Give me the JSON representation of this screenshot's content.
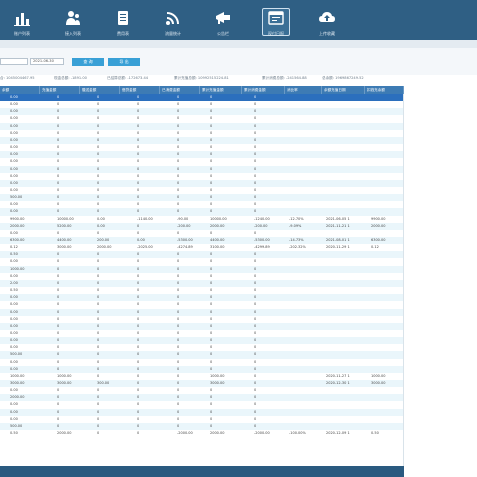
{
  "nav": [
    {
      "label": "账户列表",
      "icon": "bar-chart-icon"
    },
    {
      "label": "接入列表",
      "icon": "users-icon"
    },
    {
      "label": "费用表",
      "icon": "document-icon"
    },
    {
      "label": "流量统计",
      "icon": "signal-icon"
    },
    {
      "label": "公告栏",
      "icon": "megaphone-icon"
    },
    {
      "label": "现付日报",
      "icon": "window-report-icon",
      "active": true
    },
    {
      "label": "上传收藏",
      "icon": "cloud-upload-icon"
    }
  ],
  "filter": {
    "date_from": "",
    "date_to": "2021-06-30",
    "search_label": "查 询",
    "export_label": "导 出"
  },
  "summary": [
    "合: 1045004467.95",
    "现金总额: -1891.00",
    "已结算总额: -172673.44",
    "累计充值总额: 10992515224.81",
    "累计消费总额: -241564.88",
    "总余额: 1969867249.52"
  ],
  "columns": [
    "余额",
    "充值金额",
    "赠送金额",
    "借贷金额",
    "已消费金额",
    "累计充值金额",
    "累计消费金额",
    "消比率",
    "余额充值日期",
    "扣钱充余额"
  ],
  "rows": [
    [
      "0.00",
      "0",
      "0",
      "0",
      "0",
      "0",
      "0",
      "",
      "",
      ""
    ],
    [
      "0.00",
      "0",
      "0",
      "0",
      "0",
      "0",
      "0",
      "",
      "",
      ""
    ],
    [
      "0.00",
      "0",
      "0",
      "0",
      "0",
      "0",
      "0",
      "",
      "",
      ""
    ],
    [
      "0.00",
      "0",
      "0",
      "0",
      "0",
      "0",
      "0",
      "",
      "",
      ""
    ],
    [
      "0.00",
      "0",
      "0",
      "0",
      "0",
      "0",
      "0",
      "",
      "",
      ""
    ],
    [
      "0.00",
      "0",
      "0",
      "0",
      "0",
      "0",
      "0",
      "",
      "",
      ""
    ],
    [
      "0.00",
      "0",
      "0",
      "0",
      "0",
      "0",
      "0",
      "",
      "",
      ""
    ],
    [
      "0.00",
      "0",
      "0",
      "0",
      "0",
      "0",
      "0",
      "",
      "",
      ""
    ],
    [
      "0.00",
      "0",
      "0",
      "0",
      "0",
      "0",
      "0",
      "",
      "",
      ""
    ],
    [
      "0.00",
      "0",
      "0",
      "0",
      "0",
      "0",
      "0",
      "",
      "",
      ""
    ],
    [
      "0.00",
      "0",
      "0",
      "0",
      "0",
      "0",
      "0",
      "",
      "",
      ""
    ],
    [
      "0.00",
      "0",
      "0",
      "0",
      "0",
      "0",
      "0",
      "",
      "",
      ""
    ],
    [
      "0.00",
      "0",
      "0",
      "0",
      "0",
      "0",
      "0",
      "",
      "",
      ""
    ],
    [
      "0.00",
      "0",
      "0",
      "0",
      "0",
      "0",
      "0",
      "",
      "",
      ""
    ],
    [
      "500.00",
      "0",
      "0",
      "0",
      "0",
      "0",
      "0",
      "",
      "",
      ""
    ],
    [
      "0.00",
      "0",
      "0",
      "0",
      "0",
      "0",
      "0",
      "",
      "",
      ""
    ],
    [
      "0.00",
      "0",
      "0",
      "0",
      "0",
      "0",
      "0",
      "",
      "",
      ""
    ],
    [
      "9900.00",
      "10000.00",
      "0.00",
      "-1140.00",
      "-90.00",
      "10000.00",
      "-1240.00",
      "-12.70%",
      "2021-06-05 1",
      "9900.00"
    ],
    [
      "2000.00",
      "5200.00",
      "0.00",
      "0",
      "-200.00",
      "2000.00",
      "-200.00",
      "-9.09%",
      "2021-11-21 1",
      "2000.00"
    ],
    [
      "0.00",
      "0",
      "0",
      "0",
      "0",
      "0",
      "0",
      "",
      "",
      ""
    ],
    [
      "6300.00",
      "4400.00",
      "200.00",
      "0.00",
      "-5300.00",
      "4400.00",
      "-5300.00",
      "-14.73%",
      "2021-08-01 1",
      "6300.00"
    ],
    [
      "0.12",
      "3000.00",
      "2000.00",
      "-2025.00",
      "-4274.89",
      "3100.00",
      "-4299.89",
      "-202.32%",
      "2020-11-29 1",
      "0.12"
    ],
    [
      "0.50",
      "0",
      "0",
      "0",
      "0",
      "0",
      "0",
      "",
      "",
      ""
    ],
    [
      "0.00",
      "0",
      "0",
      "0",
      "0",
      "0",
      "0",
      "",
      "",
      ""
    ],
    [
      "1000.00",
      "0",
      "0",
      "0",
      "0",
      "0",
      "0",
      "",
      "",
      ""
    ],
    [
      "0.00",
      "0",
      "0",
      "0",
      "0",
      "0",
      "0",
      "",
      "",
      ""
    ],
    [
      "2.00",
      "0",
      "0",
      "0",
      "0",
      "0",
      "0",
      "",
      "",
      ""
    ],
    [
      "0.50",
      "0",
      "0",
      "0",
      "0",
      "0",
      "0",
      "",
      "",
      ""
    ],
    [
      "0.00",
      "0",
      "0",
      "0",
      "0",
      "0",
      "0",
      "",
      "",
      ""
    ],
    [
      "0.00",
      "0",
      "0",
      "0",
      "0",
      "0",
      "0",
      "",
      "",
      ""
    ],
    [
      "0.00",
      "0",
      "0",
      "0",
      "0",
      "0",
      "0",
      "",
      "",
      ""
    ],
    [
      "0.00",
      "0",
      "0",
      "0",
      "0",
      "0",
      "0",
      "",
      "",
      ""
    ],
    [
      "0.00",
      "0",
      "0",
      "0",
      "0",
      "0",
      "0",
      "",
      "",
      ""
    ],
    [
      "0.00",
      "0",
      "0",
      "0",
      "0",
      "0",
      "0",
      "",
      "",
      ""
    ],
    [
      "0.00",
      "0",
      "0",
      "0",
      "0",
      "0",
      "0",
      "",
      "",
      ""
    ],
    [
      "0.00",
      "0",
      "0",
      "0",
      "0",
      "0",
      "0",
      "",
      "",
      ""
    ],
    [
      "500.00",
      "0",
      "0",
      "0",
      "0",
      "0",
      "0",
      "",
      "",
      ""
    ],
    [
      "0.00",
      "0",
      "0",
      "0",
      "0",
      "0",
      "0",
      "",
      "",
      ""
    ],
    [
      "0.00",
      "0",
      "0",
      "0",
      "0",
      "0",
      "0",
      "",
      "",
      ""
    ],
    [
      "1000.00",
      "1000.00",
      "0",
      "0",
      "0",
      "1000.00",
      "0",
      "",
      "2020-11-27 1",
      "1000.00"
    ],
    [
      "3000.00",
      "3000.00",
      "300.00",
      "0",
      "0",
      "3000.00",
      "0",
      "",
      "2020-12-30 1",
      "3000.00"
    ],
    [
      "0.00",
      "0",
      "0",
      "0",
      "0",
      "0",
      "0",
      "",
      "",
      ""
    ],
    [
      "2000.00",
      "0",
      "0",
      "0",
      "0",
      "0",
      "0",
      "",
      "",
      ""
    ],
    [
      "0.00",
      "0",
      "0",
      "0",
      "0",
      "0",
      "0",
      "",
      "",
      ""
    ],
    [
      "0.00",
      "0",
      "0",
      "0",
      "0",
      "0",
      "0",
      "",
      "",
      ""
    ],
    [
      "0.00",
      "0",
      "0",
      "0",
      "0",
      "0",
      "0",
      "",
      "",
      ""
    ],
    [
      "500.00",
      "0",
      "0",
      "0",
      "0",
      "0",
      "0",
      "",
      "",
      ""
    ],
    [
      "0.50",
      "2000.00",
      "0",
      "0",
      "-2000.00",
      "2000.00",
      "-2000.00",
      "-100.00%",
      "2020-12-09 1",
      "0.50"
    ]
  ]
}
